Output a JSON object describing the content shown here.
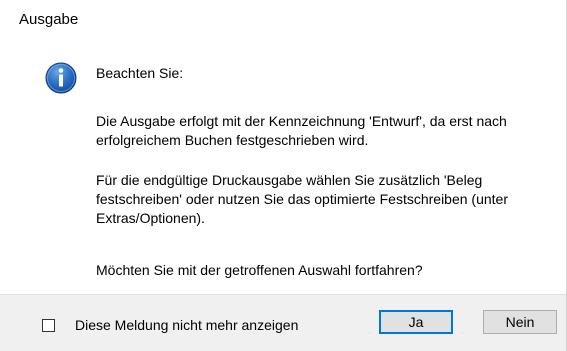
{
  "window": {
    "title": "Ausgabe"
  },
  "message": {
    "icon": "info-icon",
    "heading": "Beachten Sie:",
    "paragraph1": "Die Ausgabe erfolgt mit der Kennzeichnung 'Entwurf', da erst nach erfolgreichem Buchen festgeschrieben wird.",
    "paragraph2": "Für die endgültige Druckausgabe wählen Sie zusätzlich 'Beleg festschreiben' oder nutzen Sie das optimierte Festschreiben (unter Extras/Optionen).",
    "paragraph3": "Möchten Sie mit der getroffenen Auswahl fortfahren?"
  },
  "footer": {
    "checkbox_label": "Diese Meldung nicht mehr anzeigen",
    "checkbox_checked": false,
    "yes_label": "Ja",
    "no_label": "Nein"
  },
  "colors": {
    "icon_blue": "#1f62b5",
    "default_button_border": "#0078d7",
    "footer_background": "#f0f0f0"
  }
}
